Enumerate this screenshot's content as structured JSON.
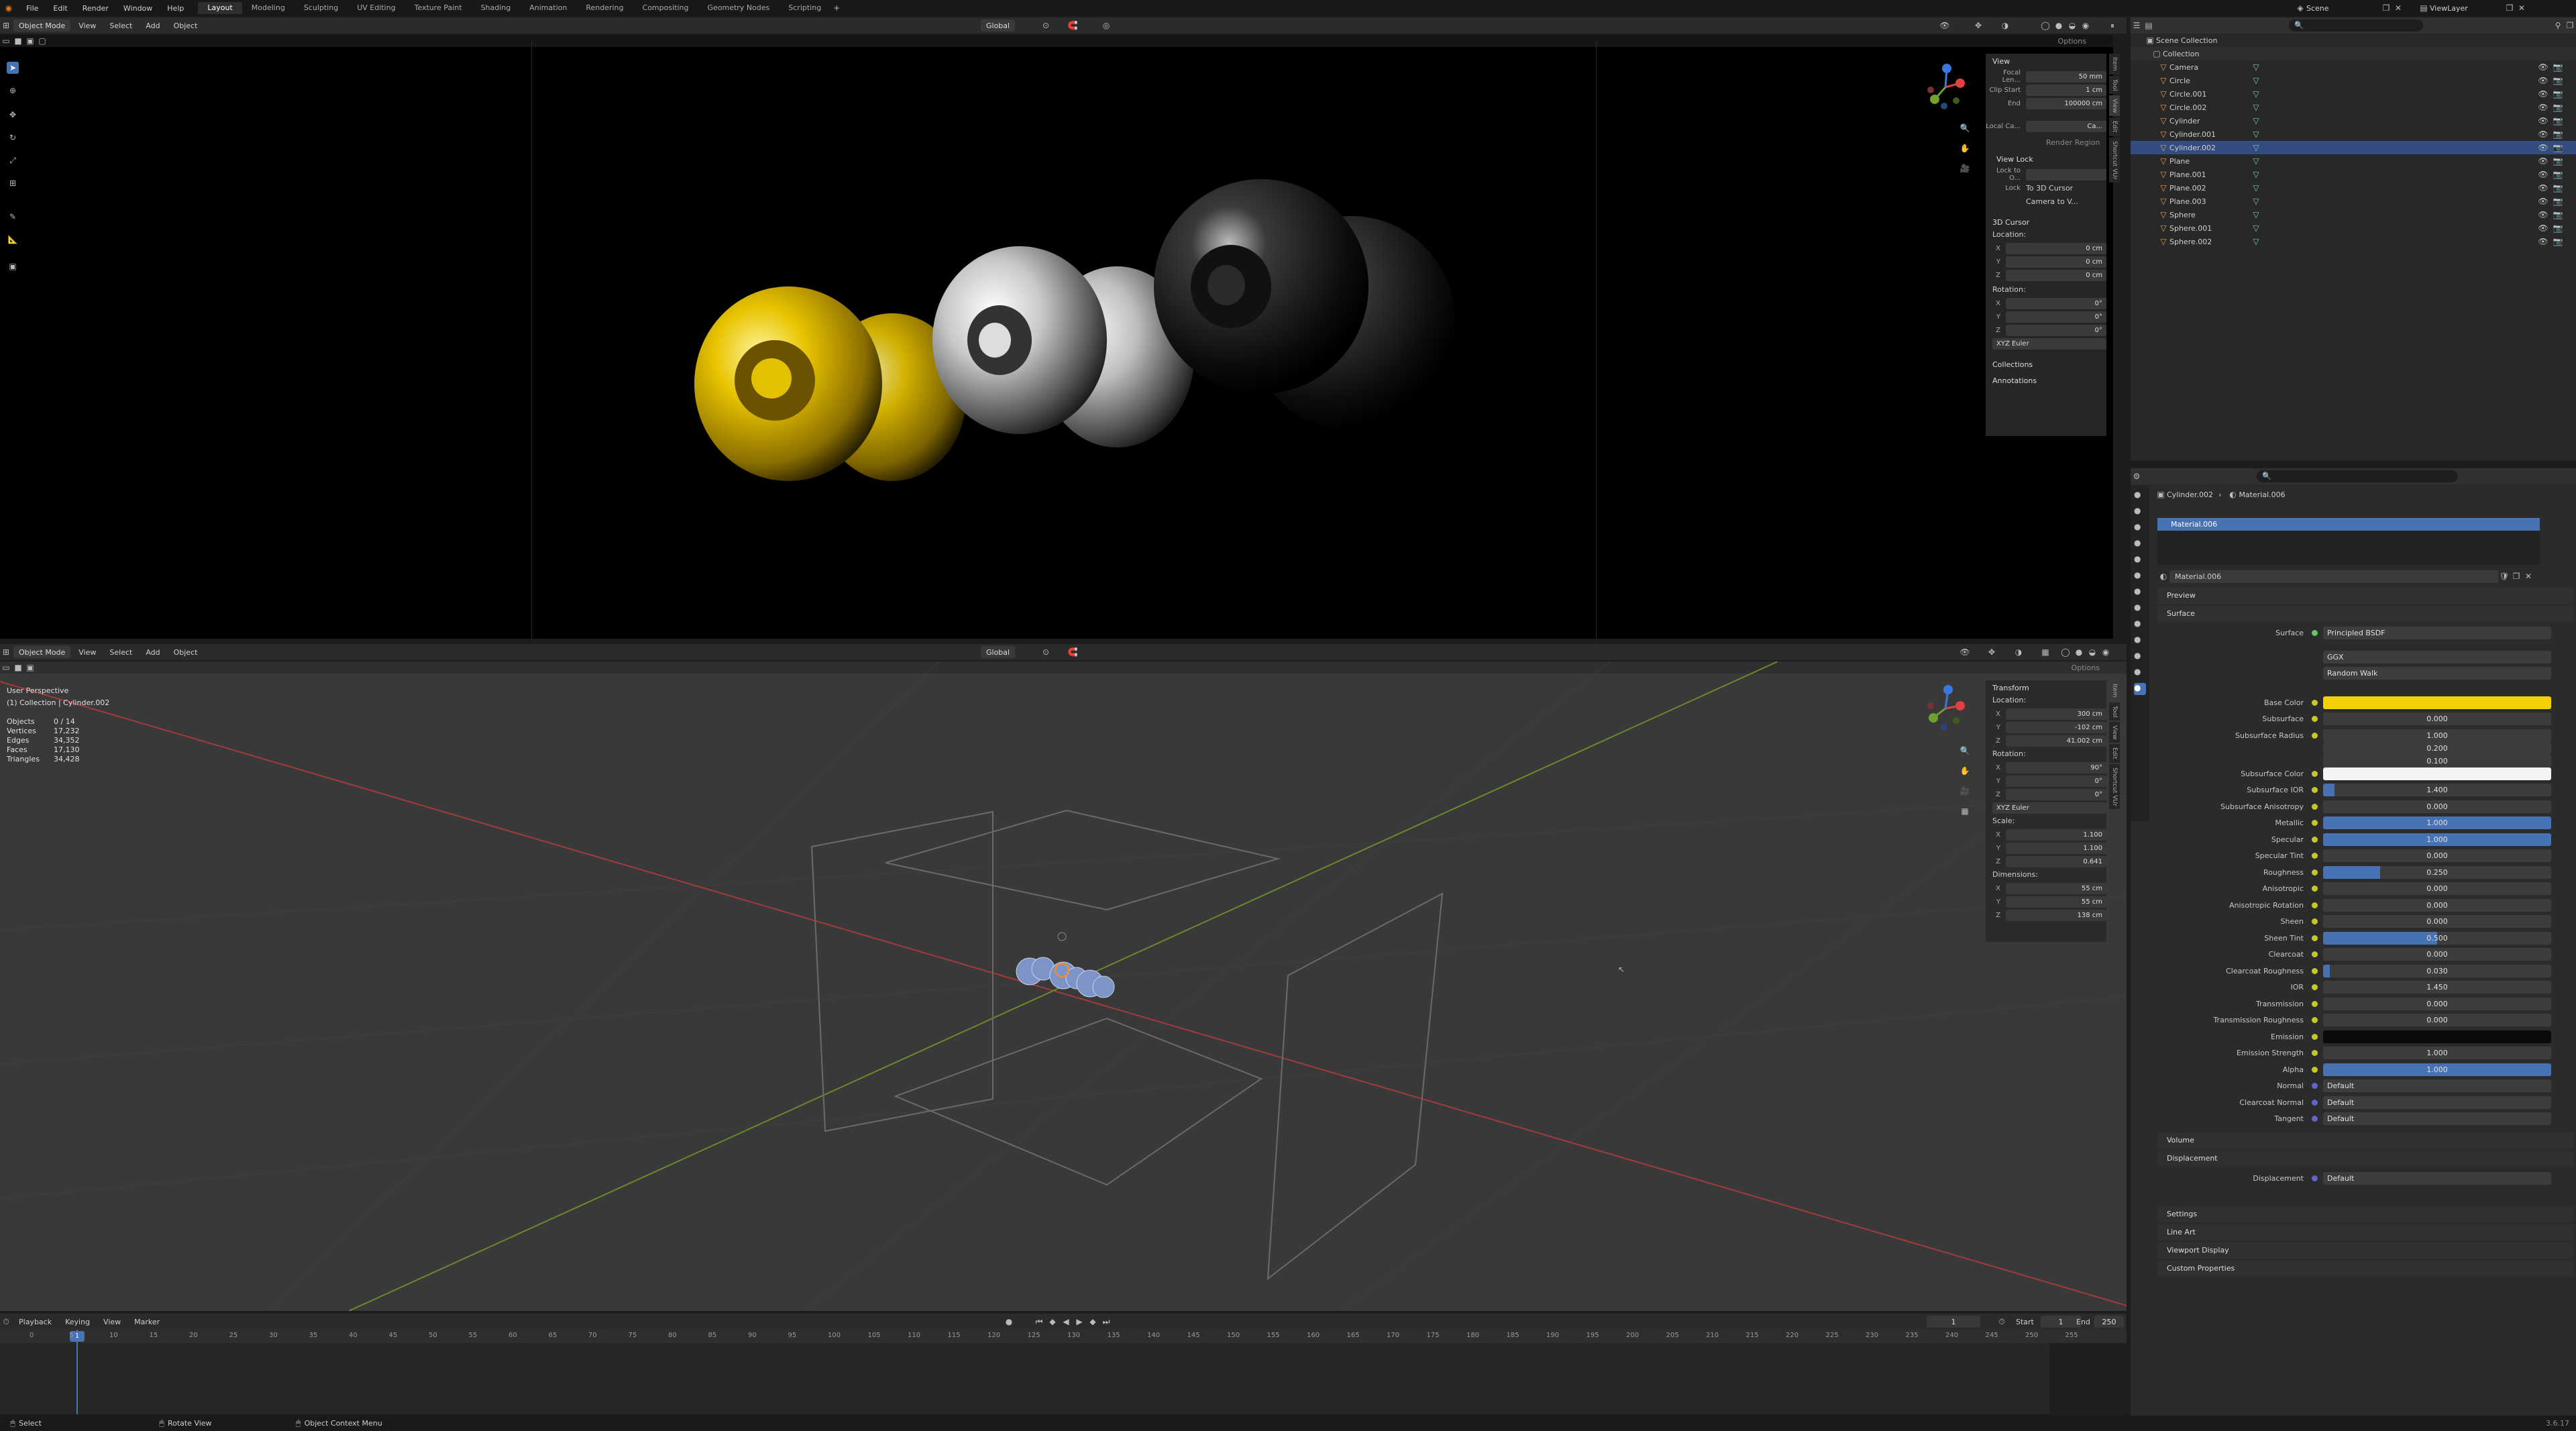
{
  "menu": [
    "File",
    "Edit",
    "Render",
    "Window",
    "Help"
  ],
  "workspaces": [
    "Layout",
    "Modeling",
    "Sculpting",
    "UV Editing",
    "Texture Paint",
    "Shading",
    "Animation",
    "Rendering",
    "Compositing",
    "Geometry Nodes",
    "Scripting"
  ],
  "active_workspace": "Layout",
  "scene": "Scene",
  "view_layer": "ViewLayer",
  "top_viewport": {
    "mode": "Object Mode",
    "menus": [
      "View",
      "Select",
      "Add",
      "Object"
    ],
    "orientation": "Global",
    "options": "Options",
    "npanel": {
      "view_title": "View",
      "focal_label": "Focal Len...",
      "focal_value": "50 mm",
      "clip_start_label": "Clip Start",
      "clip_start_value": "1 cm",
      "clip_end_label": "End",
      "clip_end_value": "100000 cm",
      "local_camera_label": "Local Ca...",
      "local_camera_value": "Ca...",
      "render_region": "Render Region",
      "view_lock_title": "View Lock",
      "lock_to_obj_label": "Lock to O...",
      "lock_label": "Lock",
      "lock_value": "To 3D Cursor",
      "camera_to_view": "Camera to V...",
      "cursor_title": "3D Cursor",
      "location_label": "Location:",
      "loc": [
        {
          "axis": "X",
          "val": "0 cm"
        },
        {
          "axis": "Y",
          "val": "0 cm"
        },
        {
          "axis": "Z",
          "val": "0 cm"
        }
      ],
      "rotation_label": "Rotation:",
      "rot": [
        {
          "axis": "X",
          "val": "0°"
        },
        {
          "axis": "Y",
          "val": "0°"
        },
        {
          "axis": "Z",
          "val": "0°"
        }
      ],
      "rot_mode": "XYZ Euler",
      "collections": "Collections",
      "annotations": "Annotations"
    },
    "side_tabs": [
      "Item",
      "Tool",
      "View",
      "Edit",
      "Shortcut VUr"
    ]
  },
  "bottom_viewport": {
    "mode": "Object Mode",
    "menus": [
      "View",
      "Select",
      "Add",
      "Object"
    ],
    "orientation": "Global",
    "options": "Options",
    "overlay_title": "User Perspective",
    "overlay_sub": "(1) Collection | Cylinder.002",
    "stats": [
      {
        "k": "Objects",
        "v": "0 / 14"
      },
      {
        "k": "Vertices",
        "v": "17,232"
      },
      {
        "k": "Edges",
        "v": "34,352"
      },
      {
        "k": "Faces",
        "v": "17,130"
      },
      {
        "k": "Triangles",
        "v": "34,428"
      }
    ],
    "transform": {
      "title": "Transform",
      "location_label": "Location:",
      "loc": [
        {
          "axis": "X",
          "val": "300 cm"
        },
        {
          "axis": "Y",
          "val": "-102 cm"
        },
        {
          "axis": "Z",
          "val": "41.002 cm"
        }
      ],
      "rotation_label": "Rotation:",
      "rot": [
        {
          "axis": "X",
          "val": "90°"
        },
        {
          "axis": "Y",
          "val": "0°"
        },
        {
          "axis": "Z",
          "val": "0°"
        }
      ],
      "rot_mode": "XYZ Euler",
      "scale_label": "Scale:",
      "scale": [
        {
          "axis": "X",
          "val": "1.100"
        },
        {
          "axis": "Y",
          "val": "1.100"
        },
        {
          "axis": "Z",
          "val": "0.641"
        }
      ],
      "dimensions_label": "Dimensions:",
      "dim": [
        {
          "axis": "X",
          "val": "55 cm"
        },
        {
          "axis": "Y",
          "val": "55 cm"
        },
        {
          "axis": "Z",
          "val": "138 cm"
        }
      ]
    }
  },
  "outliner": {
    "root": "Scene Collection",
    "collection": "Collection",
    "items": [
      "Camera",
      "Circle",
      "Circle.001",
      "Circle.002",
      "Cylinder",
      "Cylinder.001",
      "Cylinder.002",
      "Plane",
      "Plane.001",
      "Plane.002",
      "Plane.003",
      "Sphere",
      "Sphere.001",
      "Sphere.002"
    ]
  },
  "properties": {
    "breadcrumb_obj": "Cylinder.002",
    "breadcrumb_mat": "Material.006",
    "slot": "Material.006",
    "material_name": "Material.006",
    "sections_top": [
      "Preview",
      "Surface"
    ],
    "surface_label": "Surface",
    "surface_value": "Principled BSDF",
    "distribution": "GGX",
    "subsurface_method": "Random Walk",
    "rows": [
      {
        "label": "Base Color",
        "value": "",
        "kind": "color",
        "color": "#f2d106"
      },
      {
        "label": "Subsurface",
        "value": "0.000",
        "fill": 0
      },
      {
        "label": "Subsurface Radius",
        "value": "1.000",
        "fill": 0
      },
      {
        "label": "",
        "value": "0.200",
        "fill": 0
      },
      {
        "label": "",
        "value": "0.100",
        "fill": 0
      },
      {
        "label": "Subsurface Color",
        "value": "",
        "kind": "color",
        "color": "#f4f4f4"
      },
      {
        "label": "Subsurface IOR",
        "value": "1.400",
        "fill": 0.05
      },
      {
        "label": "Subsurface Anisotropy",
        "value": "0.000",
        "fill": 0
      },
      {
        "label": "Metallic",
        "value": "1.000",
        "fill": 1
      },
      {
        "label": "Specular",
        "value": "1.000",
        "fill": 1
      },
      {
        "label": "Specular Tint",
        "value": "0.000",
        "fill": 0
      },
      {
        "label": "Roughness",
        "value": "0.250",
        "fill": 0.25
      },
      {
        "label": "Anisotropic",
        "value": "0.000",
        "fill": 0
      },
      {
        "label": "Anisotropic Rotation",
        "value": "0.000",
        "fill": 0
      },
      {
        "label": "Sheen",
        "value": "0.000",
        "fill": 0
      },
      {
        "label": "Sheen Tint",
        "value": "0.500",
        "fill": 0.5
      },
      {
        "label": "Clearcoat",
        "value": "0.000",
        "fill": 0
      },
      {
        "label": "Clearcoat Roughness",
        "value": "0.030",
        "fill": 0.03
      },
      {
        "label": "IOR",
        "value": "1.450",
        "fill": 0
      },
      {
        "label": "Transmission",
        "value": "0.000",
        "fill": 0
      },
      {
        "label": "Transmission Roughness",
        "value": "0.000",
        "fill": 0
      },
      {
        "label": "Emission",
        "value": "",
        "kind": "color",
        "color": "#0a0a0a"
      },
      {
        "label": "Emission Strength",
        "value": "1.000",
        "fill": 0
      },
      {
        "label": "Alpha",
        "value": "1.000",
        "fill": 1
      },
      {
        "label": "Normal",
        "value": "Default",
        "kind": "link"
      },
      {
        "label": "Clearcoat Normal",
        "value": "Default",
        "kind": "link"
      },
      {
        "label": "Tangent",
        "value": "Default",
        "kind": "link"
      }
    ],
    "volume": "Volume",
    "displacement_title": "Displacement",
    "displacement_label": "Displacement",
    "displacement_value": "Default",
    "bottom_sections": [
      "Settings",
      "Line Art",
      "Viewport Display",
      "Custom Properties"
    ]
  },
  "timeline": {
    "menus": [
      "Playback",
      "Keying",
      "View",
      "Marker"
    ],
    "current_frame": "1",
    "start_label": "Start",
    "start": "1",
    "end_label": "End",
    "end": "250",
    "ticks": [
      "0",
      "5",
      "10",
      "15",
      "20",
      "25",
      "30",
      "35",
      "40",
      "45",
      "50",
      "55",
      "60",
      "65",
      "70",
      "75",
      "80",
      "85",
      "90",
      "95",
      "100",
      "105",
      "110",
      "115",
      "120",
      "125",
      "130",
      "135",
      "140",
      "145",
      "150",
      "155",
      "160",
      "165",
      "170",
      "175",
      "180",
      "185",
      "190",
      "195",
      "200",
      "205",
      "210",
      "215",
      "220",
      "225",
      "230",
      "235",
      "240",
      "245",
      "250",
      "255"
    ],
    "cursor_frame": "1"
  },
  "statusbar": {
    "select": "Select",
    "rotate": "Rotate View",
    "context": "Object Context Menu",
    "version": "3.6.17"
  }
}
